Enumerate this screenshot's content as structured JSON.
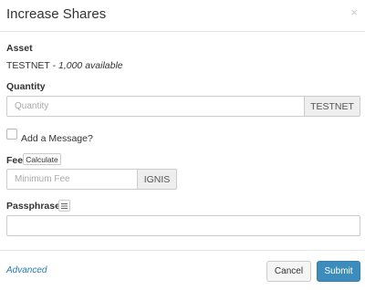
{
  "modal": {
    "title": "Increase Shares",
    "close": "×"
  },
  "asset": {
    "label": "Asset",
    "name": "TESTNET",
    "separator": " - ",
    "available": "1,000 available"
  },
  "quantity": {
    "label": "Quantity",
    "placeholder": "Quantity",
    "value": "",
    "unit": "TESTNET"
  },
  "message": {
    "label": "Add a Message?",
    "checked": false
  },
  "fee": {
    "label": "Fee",
    "calculate_label": "Calculate",
    "placeholder": "Minimum Fee",
    "value": "",
    "unit": "IGNIS"
  },
  "passphrase": {
    "label": "Passphrase",
    "value": ""
  },
  "footer": {
    "advanced_label": "Advanced",
    "cancel_label": "Cancel",
    "submit_label": "Submit"
  },
  "colors": {
    "primary": "#3c8dbc",
    "link": "#2a7ab0",
    "addon_bg": "#eeeeee",
    "border": "#cccccc"
  }
}
